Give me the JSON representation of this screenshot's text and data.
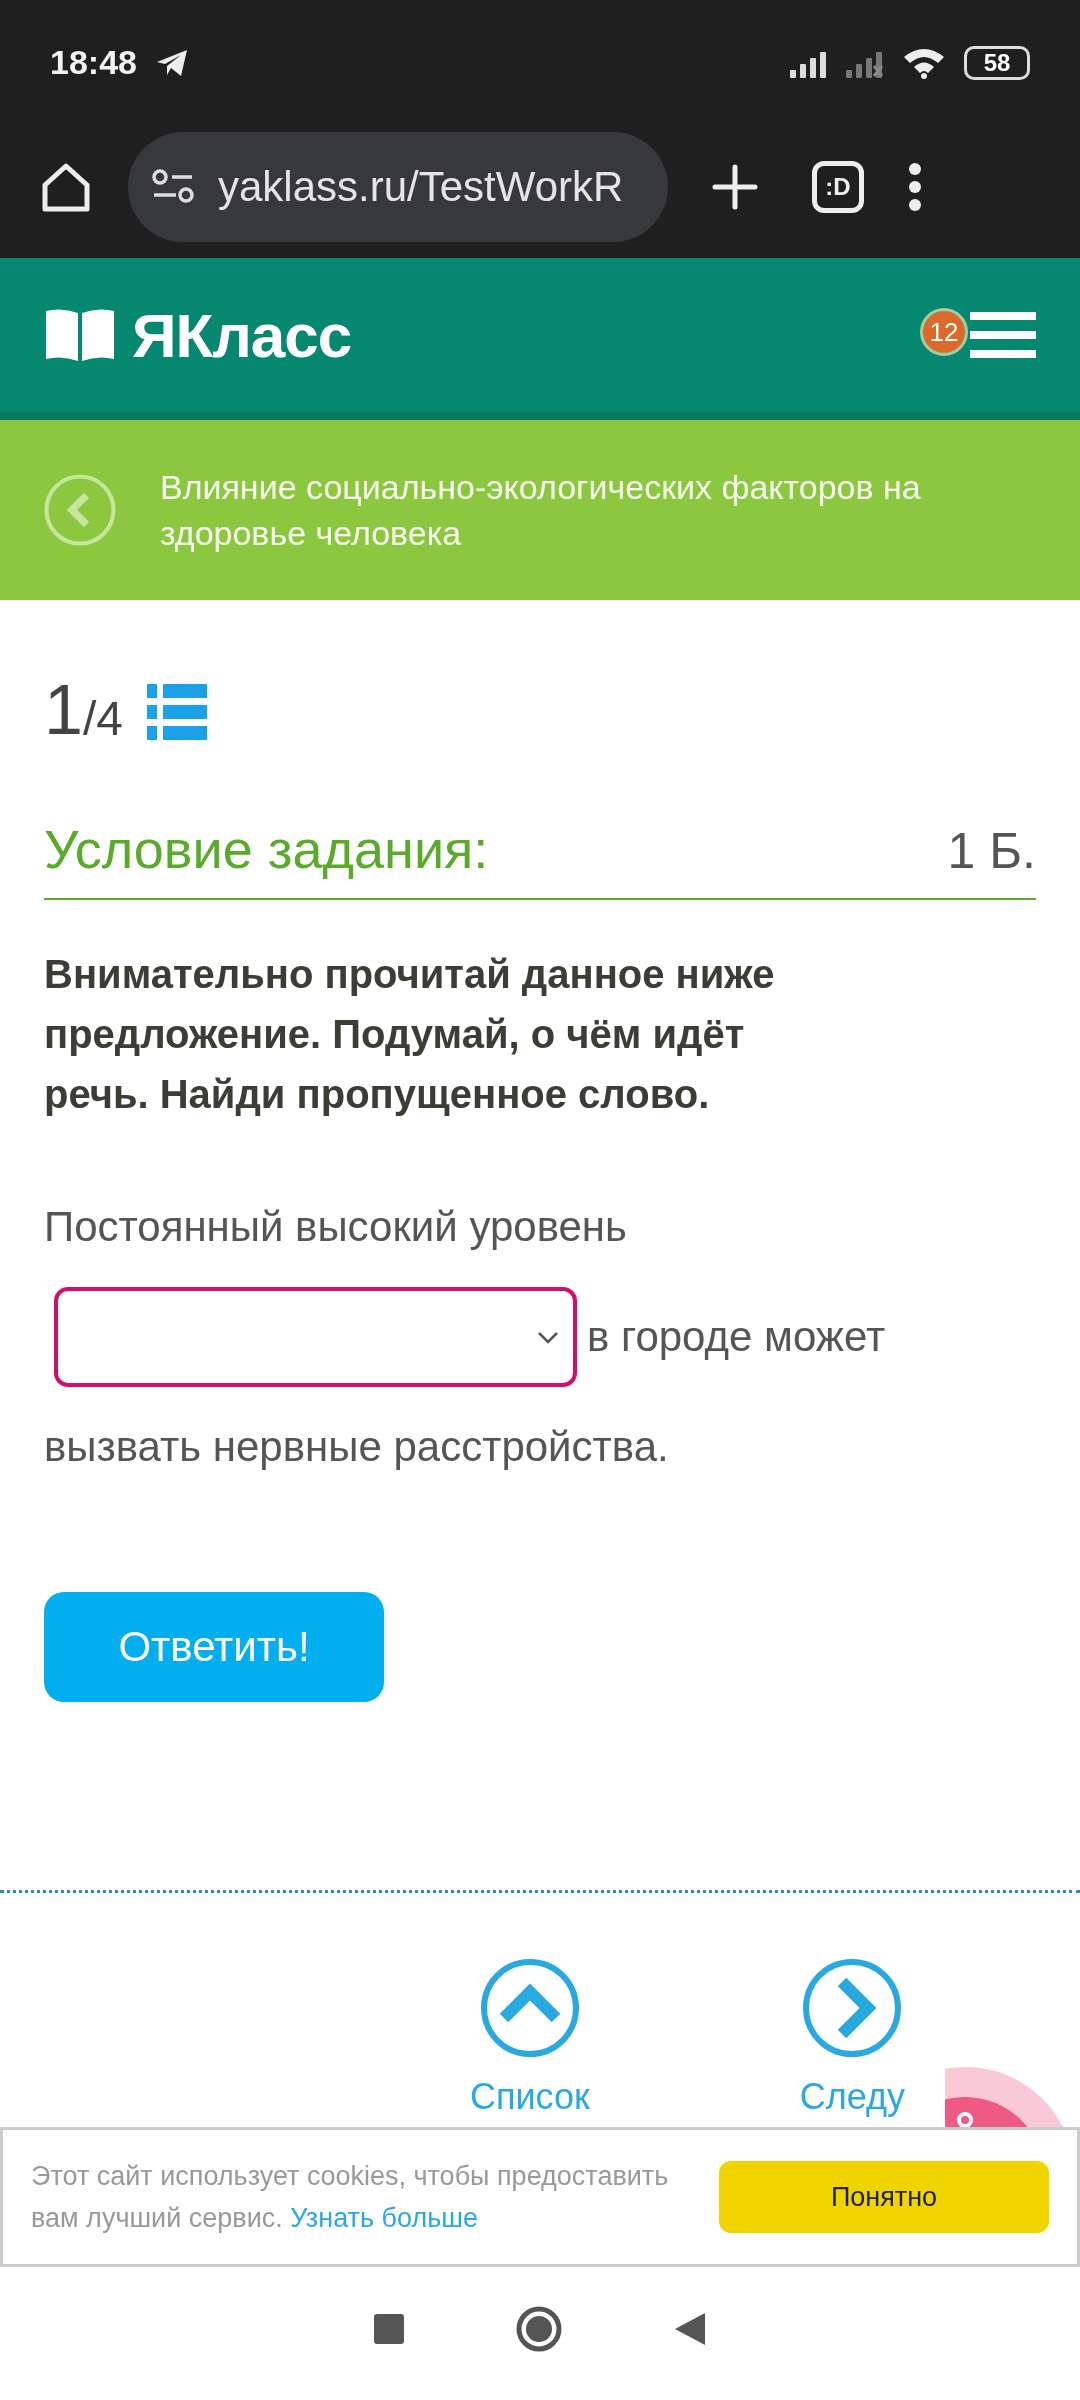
{
  "status_bar": {
    "time": "18:48",
    "battery": "58"
  },
  "browser": {
    "url": "yaklass.ru/TestWorkR",
    "tabs_label": ":D"
  },
  "header": {
    "logo": "ЯКласс",
    "notification_count": "12"
  },
  "topic": {
    "title": "Влияние социально-экологических факторов на здоровье человека"
  },
  "progress": {
    "current": "1",
    "total": "/4"
  },
  "task": {
    "heading": "Условие задания:",
    "points": "1 Б.",
    "instruction": "Внимательно прочитай данное ниже предложение. Подумай, о чём идёт речь. Найди пропущенное слово.",
    "sentence_before": "Постоянный высокий уровень",
    "sentence_after_gap": "в городе может",
    "sentence_end": "вызвать нервные расстройства.",
    "submit": "Ответить!"
  },
  "navigation": [
    {
      "label": "Список",
      "kind": "up"
    },
    {
      "label": "Следу",
      "kind": "next"
    }
  ],
  "cookie_banner": {
    "text": "Этот сайт использует cookies, чтобы предоставить вам лучший сервис.",
    "link": "Узнать больше",
    "button": "Понятно"
  }
}
